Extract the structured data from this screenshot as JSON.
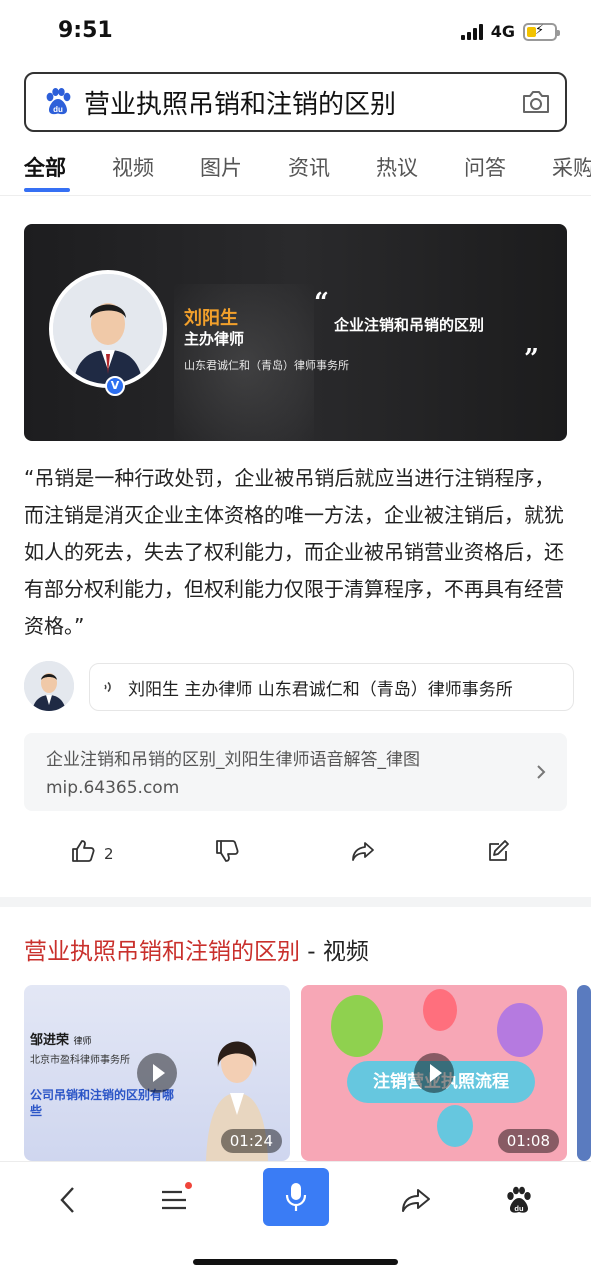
{
  "status_bar": {
    "time": "9:51",
    "network": "4G",
    "battery_level": 0.35
  },
  "search": {
    "query": "营业执照吊销和注销的区别",
    "logo_icon": "baidu-paw-icon",
    "camera_icon": "camera-icon"
  },
  "tabs": [
    {
      "label": "全部",
      "active": true
    },
    {
      "label": "视频"
    },
    {
      "label": "图片"
    },
    {
      "label": "资讯"
    },
    {
      "label": "热议"
    },
    {
      "label": "问答"
    },
    {
      "label": "采购"
    }
  ],
  "hero": {
    "name": "刘阳生",
    "role": "主办律师",
    "firm": "山东君诚仁和（青岛）律师事务所",
    "quote": "企业注销和吊销的区别",
    "open_mark": "“",
    "close_mark": "”",
    "badge": "V"
  },
  "answer": {
    "text": "“吊销是一种行政处罚，企业被吊销后就应当进行注销程序，而注销是消灭企业主体资格的唯一方法，企业被注销后，就犹如人的死去，失去了权利能力，而企业被吊销营业资格后，还有部分权利能力，但权利能力仅限于清算程序，不再具有经营资格。”"
  },
  "author": {
    "text": "刘阳生  主办律师  山东君诚仁和（青岛）律师事务所"
  },
  "source": {
    "title": "企业注销和吊销的区别_刘阳生律师语音解答_律图",
    "url": "mip.64365.com"
  },
  "actions": {
    "like_count": "2"
  },
  "video_section": {
    "title_query": "营业执照吊销和注销的区别",
    "title_suffix": " - 视频",
    "videos": [
      {
        "lawyer": "邹进荣",
        "lawyer_tag": "律师",
        "firm": "北京市盈科律师事务所",
        "title": "公司吊销和注销的区别有哪些",
        "duration": "01:24"
      },
      {
        "banner": "注销营业执照流程",
        "duration": "01:08"
      }
    ]
  },
  "bottom_nav": [
    "back-icon",
    "menu-icon",
    "microphone-icon",
    "share-icon",
    "baidu-paw-icon"
  ],
  "colors": {
    "accent": "#3670f4",
    "query_red": "#c9302c",
    "hero_name": "#f2a02b",
    "mic_button": "#3a7cf5"
  }
}
